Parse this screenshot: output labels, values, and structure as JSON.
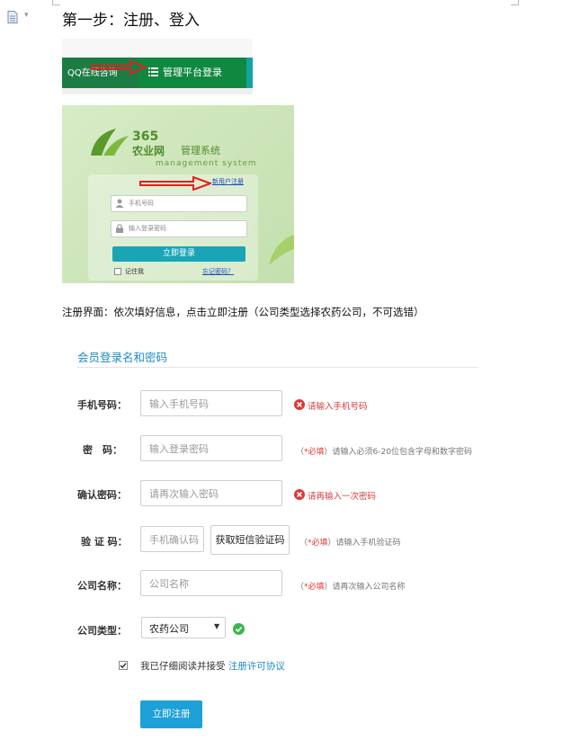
{
  "doc": {
    "step_title": "第一步：注册、登入",
    "description": "注册界面：依次填好信息，点击立即注册（公司类型选择农药公司，不可选错）"
  },
  "nav_image": {
    "left_text": "QQ在线咨询",
    "active_label": "管理平台登录"
  },
  "login_image": {
    "brand_number": "365",
    "brand_name": "农业网",
    "brand_system": "管理系统",
    "brand_english": "management system",
    "new_user_link": "新用户注册",
    "phone_placeholder": "手机号码",
    "password_placeholder": "输入登录密码",
    "login_button": "立即登录",
    "remember_me": "记住我",
    "forgot_password": "忘记密码？"
  },
  "form": {
    "section_title": "会员登录名和密码",
    "phone": {
      "label": "手机号码：",
      "placeholder": "输入手机号码",
      "error": "请输入手机号码"
    },
    "password": {
      "label": "密　码：",
      "placeholder": "输入登录密码",
      "hint_open": "（",
      "hint_star": "*必填",
      "hint_rest": "）请输入必须6-20位包含字母和数字密码"
    },
    "confirm": {
      "label": "确认密码：",
      "placeholder": "请再次输入密码",
      "error": "请再输入一次密码"
    },
    "code": {
      "label": "验 证 码：",
      "placeholder": "手机确认码",
      "button": "获取短信验证码",
      "hint_open": "（",
      "hint_star": "*必填",
      "hint_rest": "）请输入手机验证码"
    },
    "company": {
      "label": "公司名称：",
      "placeholder": "公司名称",
      "hint_open": "（",
      "hint_star": "*必填",
      "hint_rest": "）请再次输入公司名称"
    },
    "company_type": {
      "label": "公司类型：",
      "selected": "农药公司"
    },
    "agree_text": "我已仔细阅读并接受",
    "agree_link": "注册许可协议",
    "submit": "立即注册"
  },
  "colors": {
    "accent": "#1ea0d8",
    "error": "#d93a3a",
    "success": "#3bb54a",
    "nav_green": "#0b7a3a"
  }
}
